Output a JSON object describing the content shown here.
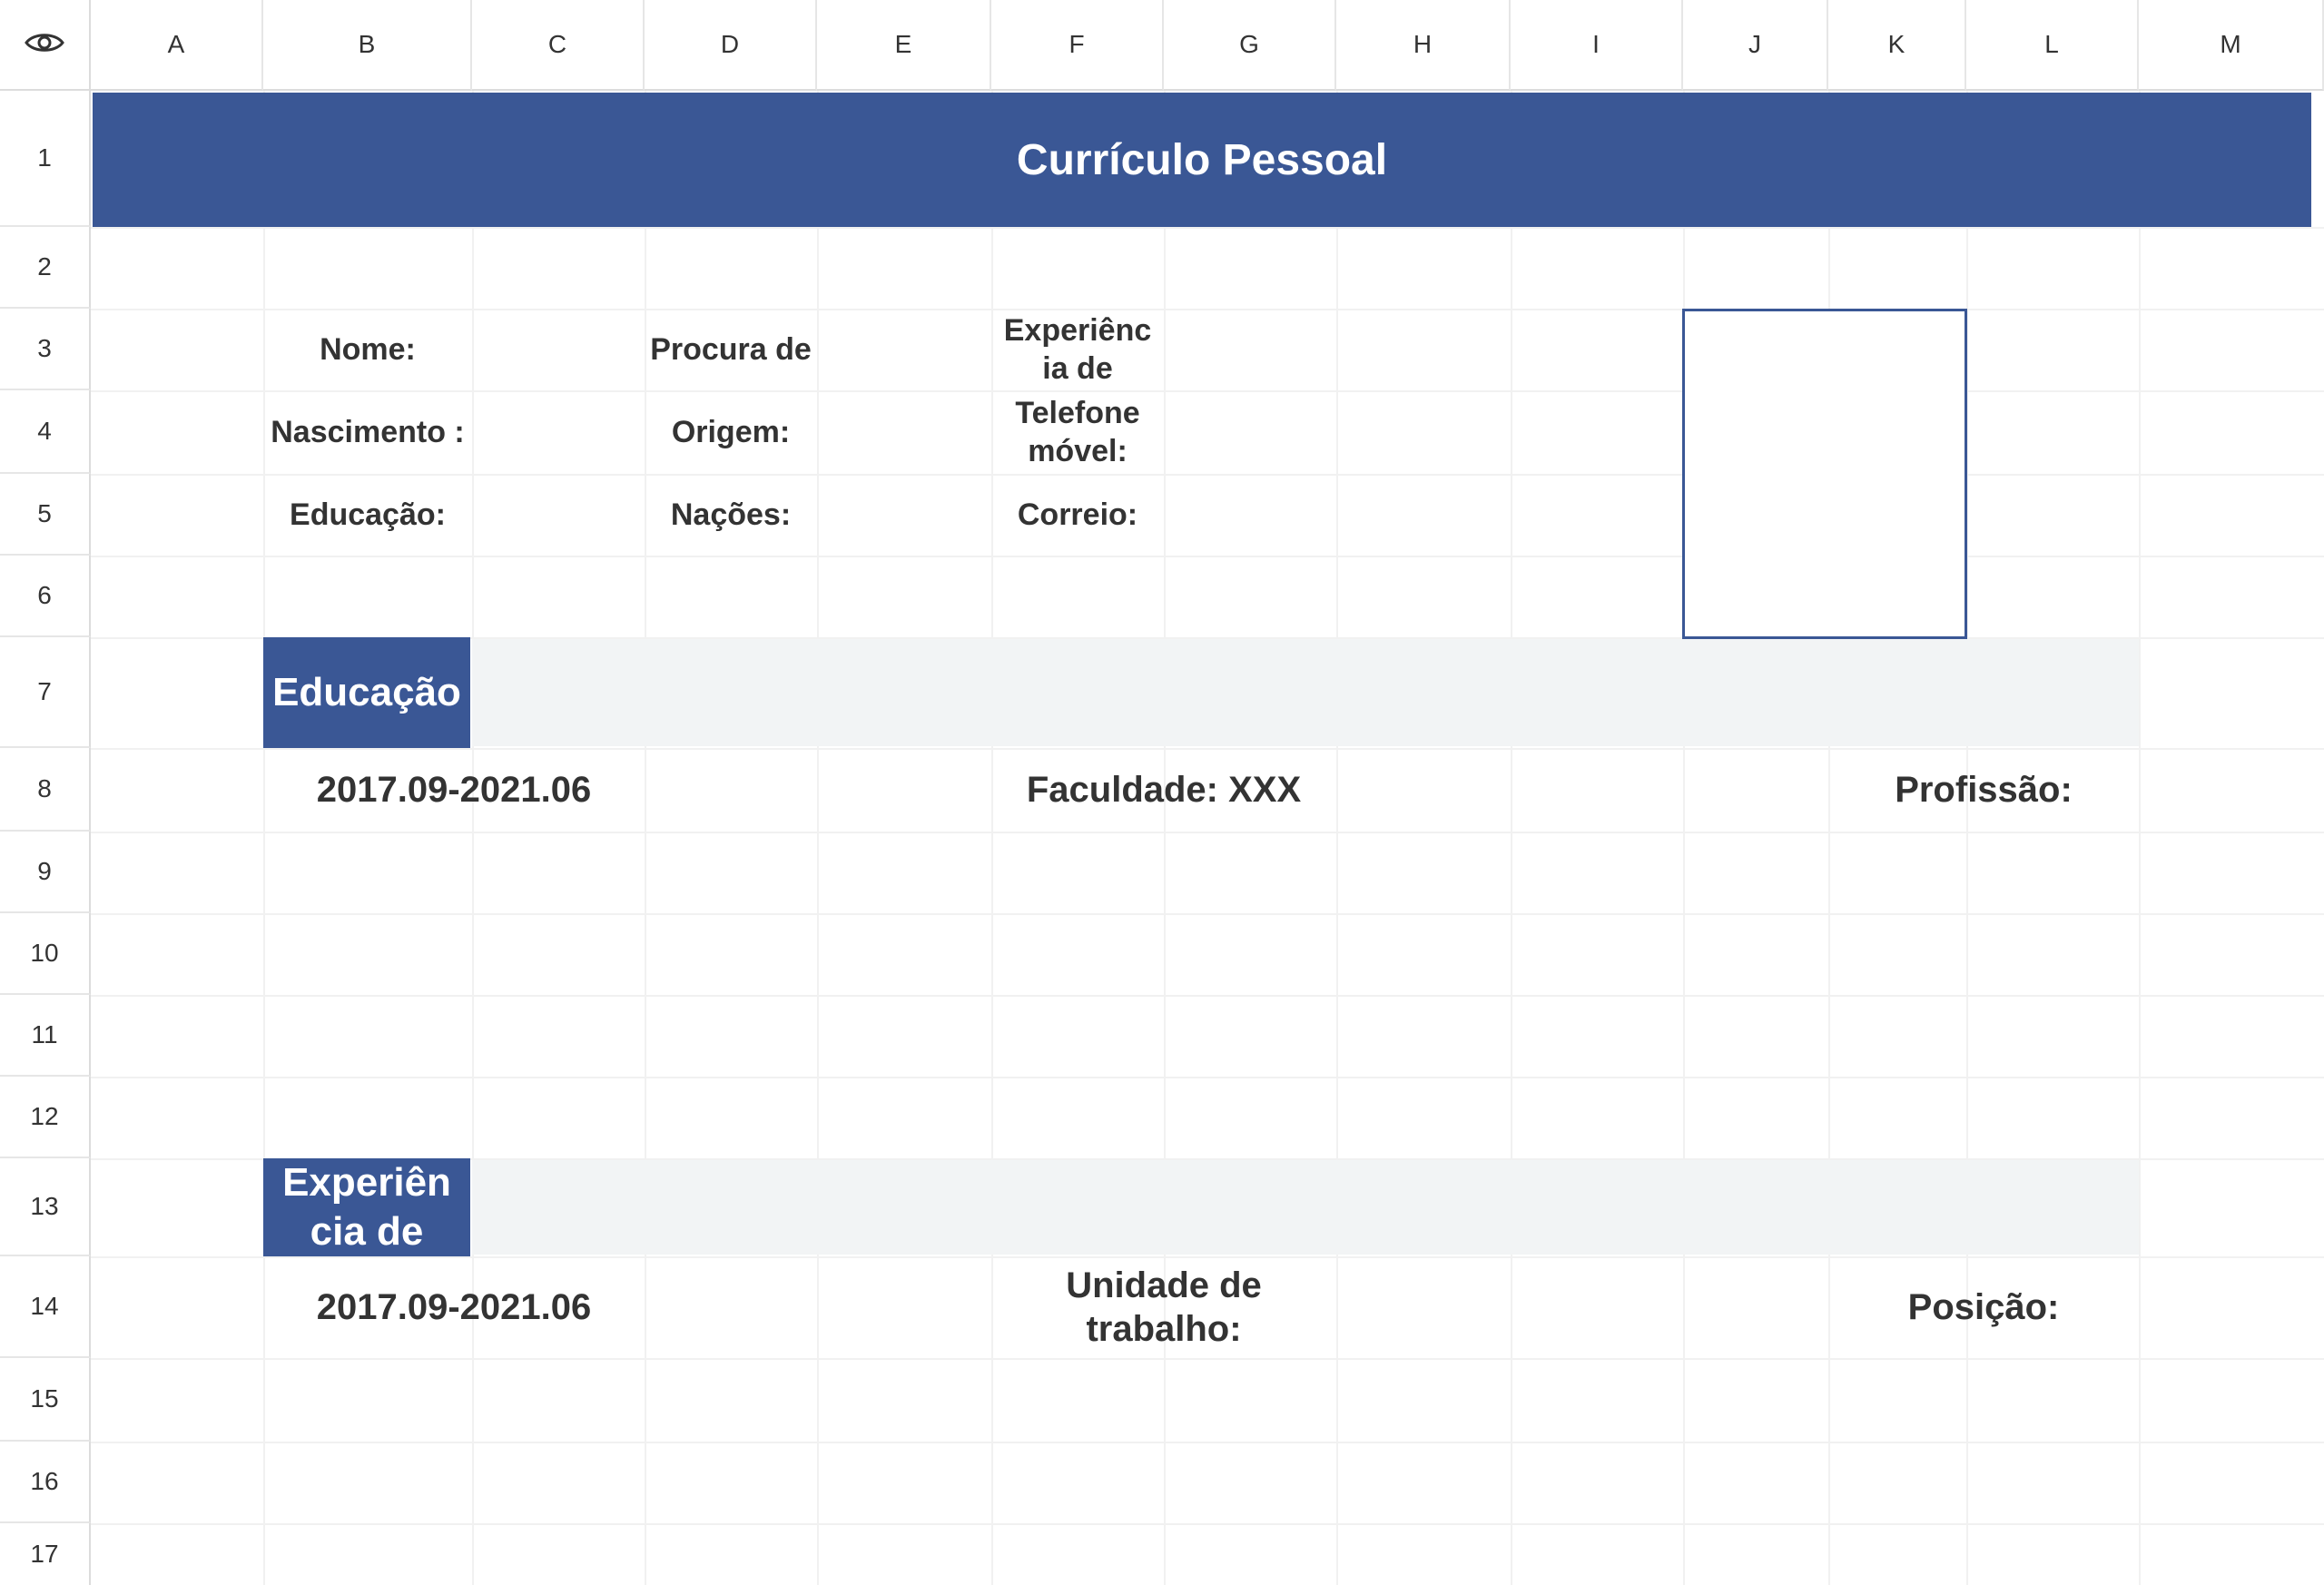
{
  "columns": [
    "A",
    "B",
    "C",
    "D",
    "E",
    "F",
    "G",
    "H",
    "I",
    "J",
    "K",
    "L",
    "M"
  ],
  "rows": [
    "1",
    "2",
    "3",
    "4",
    "5",
    "6",
    "7",
    "8",
    "9",
    "10",
    "11",
    "12",
    "13",
    "14",
    "15",
    "16",
    "17"
  ],
  "title": "Currículo Pessoal",
  "personal": {
    "nome": "Nome:",
    "procura": "Procura de",
    "experiencia": "Experiênc ia de",
    "nascimento": "Nascimento :",
    "origem": "Origem:",
    "telefone": "Telefone móvel:",
    "educacao": "Educação:",
    "nacoes": "Nações:",
    "correio": "Correio:"
  },
  "education": {
    "section_title": "Educação",
    "period": "2017.09-2021.06",
    "faculdade": "Faculdade: XXX",
    "profissao": "Profissão:"
  },
  "experience": {
    "section_title": "Experiên cia de",
    "period": "2017.09-2021.06",
    "unidade": "Unidade de trabalho:",
    "posicao": "Posição:"
  },
  "colors": {
    "accent": "#3a5795",
    "band": "#f2f4f5",
    "grid": "#f1f1f1"
  },
  "icons": {
    "view_toggle": "eye-icon"
  }
}
